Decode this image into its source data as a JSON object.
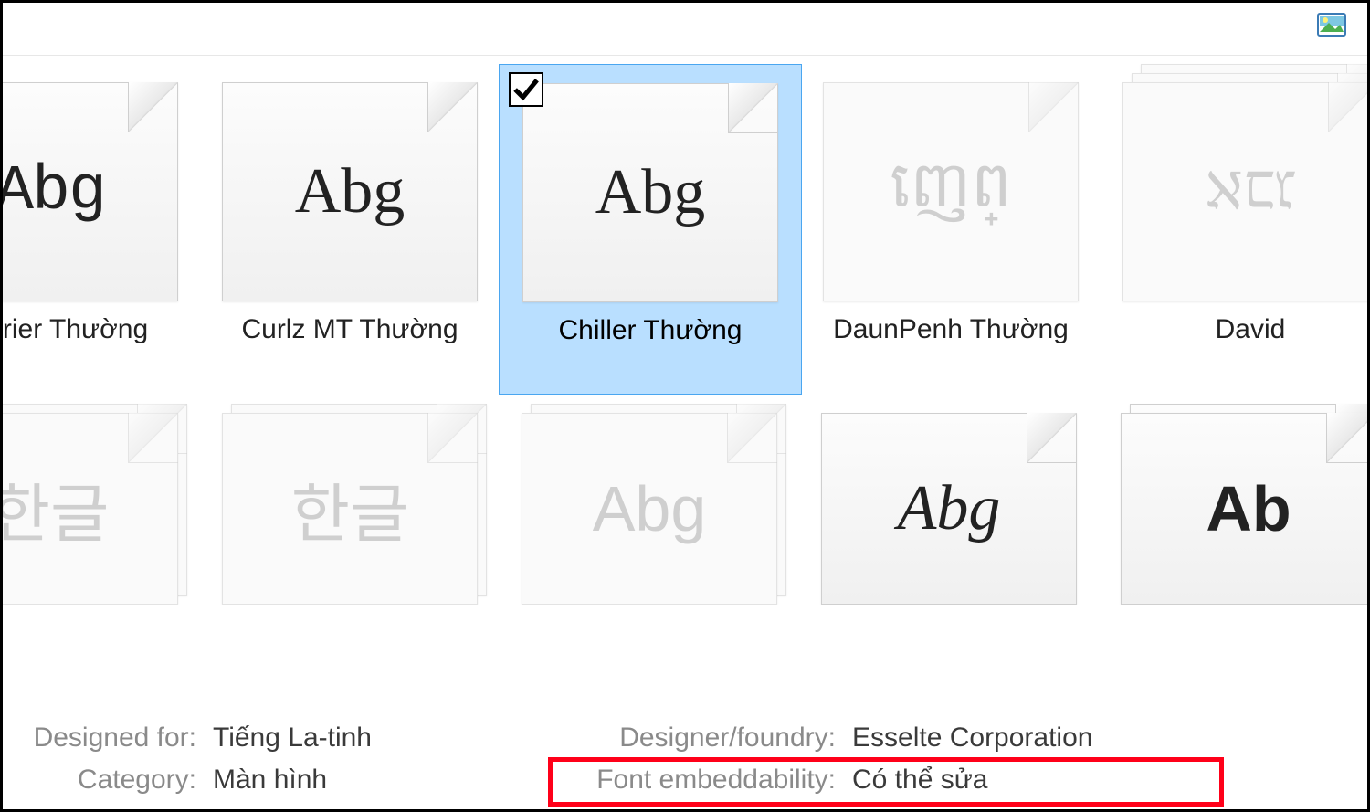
{
  "toolbar": {
    "picture_icon": "picture-icon"
  },
  "fonts_row1": [
    {
      "sample": "Abg",
      "label": "Courier Thường",
      "sample_class": "s-courier",
      "stack": false,
      "dim": false
    },
    {
      "sample": "Abg",
      "label": "Curlz MT Thường",
      "sample_class": "s-curlz",
      "stack": false,
      "dim": false
    },
    {
      "sample": "Abg",
      "label": "Chiller Thường",
      "sample_class": "s-chiller",
      "stack": false,
      "dim": false,
      "selected": true
    },
    {
      "sample": "ញេព្",
      "label": "DaunPenh Thường",
      "sample_class": "s-daun",
      "stack": false,
      "dim": true
    },
    {
      "sample": "אבג",
      "label": "David",
      "sample_class": "s-david",
      "stack": true,
      "dim": true
    }
  ],
  "fonts_row2": [
    {
      "sample": "한글",
      "sample_class": "s-hangul",
      "stack": true,
      "dim": true
    },
    {
      "sample": "한글",
      "sample_class": "s-hangul",
      "stack": true,
      "dim": true
    },
    {
      "sample": "Abg",
      "sample_class": "s-plain",
      "stack": true,
      "dim": true
    },
    {
      "sample": "Abg",
      "sample_class": "s-script",
      "stack": false,
      "dim": false
    },
    {
      "sample": "Ab",
      "sample_class": "s-elephant",
      "stack": true,
      "dim": false
    }
  ],
  "details": {
    "designed_for_label": "Designed for:",
    "designed_for_value": "Tiếng La-tinh",
    "category_label": "Category:",
    "category_value": "Màn hình",
    "foundry_label": "Designer/foundry:",
    "foundry_value": "Esselte Corporation",
    "embed_label": "Font embeddability:",
    "embed_value": "Có thể sửa"
  }
}
